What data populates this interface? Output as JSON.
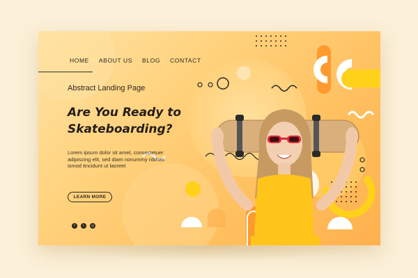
{
  "nav": {
    "items": [
      "HOME",
      "ABOUT US",
      "BLOG",
      "CONTACT"
    ]
  },
  "hero": {
    "subtitle": "Abstract Landing Page",
    "headline_line1": "Are You Ready to",
    "headline_line2": "Skateboarding?",
    "body": "Lorem ipsum dolor sit amet, consectetuer adipiscing elit, sed diam nonummy nibhas ismod tincidunt ut laoreet",
    "cta_label": "LEARN MORE"
  },
  "social": {
    "icons": [
      "facebook-icon",
      "twitter-icon",
      "instagram-icon"
    ],
    "glyphs": [
      "f",
      "t",
      "◎"
    ]
  },
  "colors": {
    "page_bg": "#fbf0d8",
    "card_gradient_start": "#ffe3a6",
    "card_gradient_end": "#ffb04e",
    "text": "#241d18",
    "accent_yellow": "#ffd21a"
  }
}
